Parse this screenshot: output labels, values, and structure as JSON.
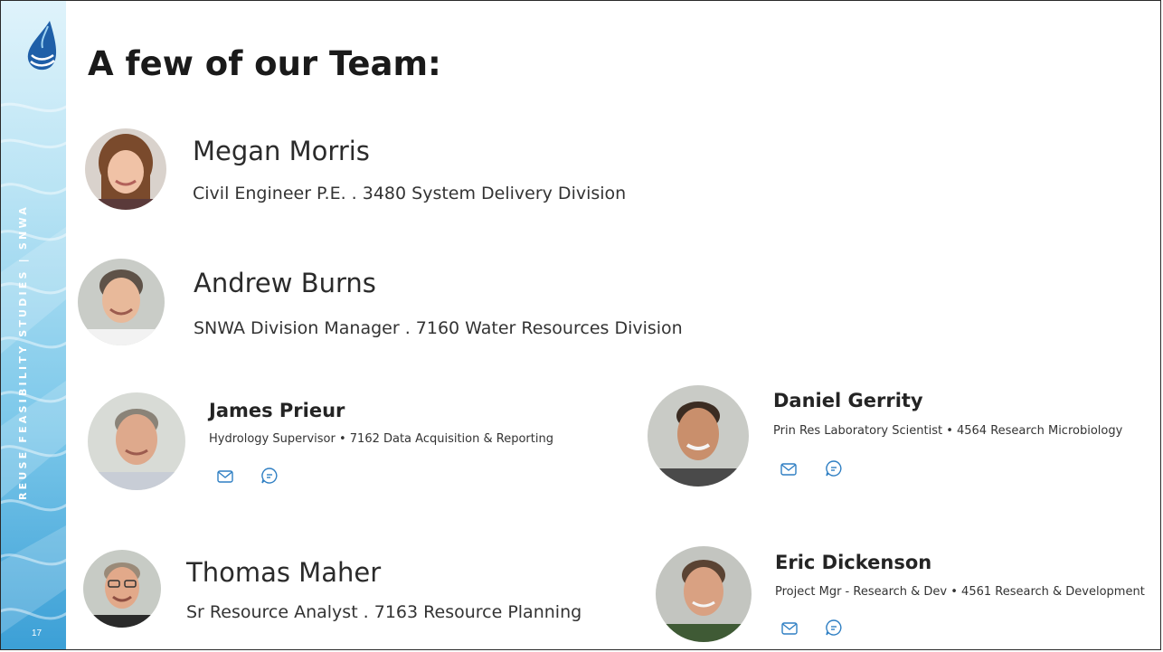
{
  "brand": {
    "vertical_text": "REUSE FEASIBILITY STUDIES | SNWA",
    "page_number": "17",
    "logo_icon": "water-drop-logo-icon"
  },
  "slide": {
    "title": "A few of our Team:"
  },
  "colors": {
    "accent": "#2f7fc3",
    "strip_top": "#dff3fb",
    "strip_bottom": "#3b9fd6"
  },
  "team": [
    {
      "name": "Megan Morris",
      "role": "Civil Engineer P.E. . 3480 System Delivery Division"
    },
    {
      "name": "Andrew Burns",
      "role": "SNWA Division Manager . 7160 Water Resources Division"
    },
    {
      "name": "James Prieur",
      "role": "Hydrology Supervisor • 7162 Data Acquisition & Reporting",
      "actions": [
        "mail-icon",
        "chat-icon"
      ]
    },
    {
      "name": "Daniel Gerrity",
      "role": "Prin Res Laboratory Scientist • 4564 Research Microbiology",
      "actions": [
        "mail-icon",
        "chat-icon"
      ]
    },
    {
      "name": "Thomas Maher",
      "role": "Sr Resource Analyst . 7163 Resource Planning"
    },
    {
      "name": "Eric Dickenson",
      "role": "Project Mgr - Research & Dev • 4561 Research & Development",
      "actions": [
        "mail-icon",
        "chat-icon"
      ]
    }
  ]
}
